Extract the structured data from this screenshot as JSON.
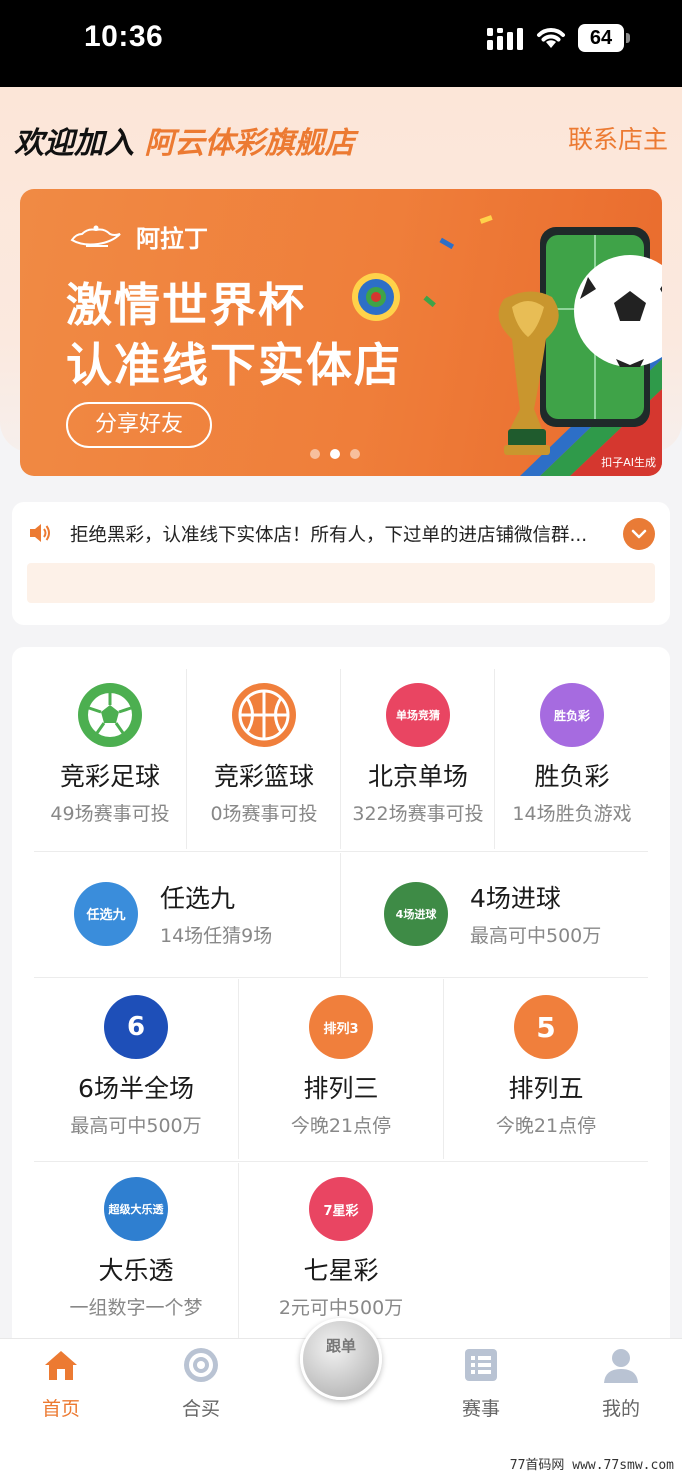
{
  "status_bar": {
    "time": "10:36",
    "battery": "64"
  },
  "header": {
    "welcome_prefix": "欢迎加入",
    "store_name": "阿云体彩旗舰店",
    "contact_label": "联系店主"
  },
  "banner": {
    "brand": "阿拉丁",
    "headline_1": "激情世界杯",
    "headline_2": "认准线下实体店",
    "share_label": "分享好友",
    "ai_tag": "扣子AI生成",
    "slides": 3,
    "active_slide": 2
  },
  "notice": {
    "text": "拒绝黑彩，认准线下实体店！所有人，下过单的进店铺微信群..."
  },
  "lotteries": [
    {
      "title": "竞彩足球",
      "sub": "49场赛事可投",
      "icon": "soccer-ball-icon",
      "color": "#4caf50"
    },
    {
      "title": "竞彩篮球",
      "sub": "0场赛事可投",
      "icon": "basketball-icon",
      "color": "#f07f3c"
    },
    {
      "title": "北京单场",
      "sub": "322场赛事可投",
      "icon": "beijing-single-icon",
      "icon_text": "单场竞猜",
      "color": "#e94562"
    },
    {
      "title": "胜负彩",
      "sub": "14场胜负游戏",
      "icon": "win-lose-icon",
      "icon_text": "胜负彩",
      "color": "#a66be0"
    },
    {
      "title": "任选九",
      "sub": "14场任猜9场",
      "icon": "pick-nine-icon",
      "icon_text": "任选九",
      "color": "#3a8ddb"
    },
    {
      "title": "4场进球",
      "sub": "最高可中500万",
      "icon": "four-goals-icon",
      "icon_text": "4场进球",
      "color": "#3e8b46"
    },
    {
      "title": "6场半全场",
      "sub": "最高可中500万",
      "icon": "six-halftime-icon",
      "icon_text": "6",
      "color": "#1e4fb8"
    },
    {
      "title": "排列三",
      "sub": "今晚21点停",
      "icon": "pick-three-icon",
      "icon_text": "排列3",
      "color": "#f07f3c"
    },
    {
      "title": "排列五",
      "sub": "今晚21点停",
      "icon": "pick-five-icon",
      "icon_text": "5",
      "color": "#f07f3c"
    },
    {
      "title": "大乐透",
      "sub": "一组数字一个梦",
      "icon": "super-lotto-icon",
      "icon_text": "超级大乐透",
      "color": "#2f7fd0"
    },
    {
      "title": "七星彩",
      "sub": "2元可中500万",
      "icon": "seven-star-icon",
      "icon_text": "7星彩",
      "color": "#e94562"
    }
  ],
  "tabs": [
    {
      "label": "首页",
      "icon": "home-icon",
      "active": true
    },
    {
      "label": "合买",
      "icon": "target-icon",
      "active": false
    },
    {
      "label": "赛事",
      "icon": "list-icon",
      "active": false
    },
    {
      "label": "我的",
      "icon": "user-icon",
      "active": false
    }
  ],
  "follow_button": {
    "label": "跟单"
  },
  "watermark": "77首码网 www.77smw.com"
}
